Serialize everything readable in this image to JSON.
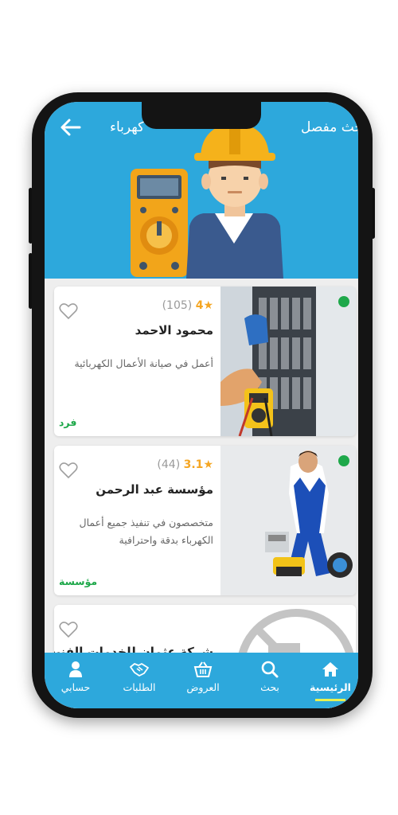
{
  "header": {
    "title": "كهرباء",
    "advanced_search": "بحث مفصل"
  },
  "cards": [
    {
      "rating": "4",
      "reviews": "(105)",
      "name": "محمود الاحمد",
      "description": "أعمل في صيانة الأعمال الكهربائية",
      "type": "فرد"
    },
    {
      "rating": "3.1",
      "reviews": "(44)",
      "name": "مؤسسة عبد الرحمن",
      "description": "متخصصون في تنفيذ جميع أعمال الكهرباء بدقة واحترافية",
      "type": "مؤسسة"
    },
    {
      "name": "شركة عثمان للخدمات الفنية"
    }
  ],
  "tabs": {
    "home": "الرئيسية",
    "search": "بحث",
    "offers": "العروض",
    "orders": "الطلبات",
    "account": "حسابي"
  },
  "colors": {
    "primary": "#2da8dc",
    "online": "#1ea84a",
    "star": "#f5a623"
  }
}
